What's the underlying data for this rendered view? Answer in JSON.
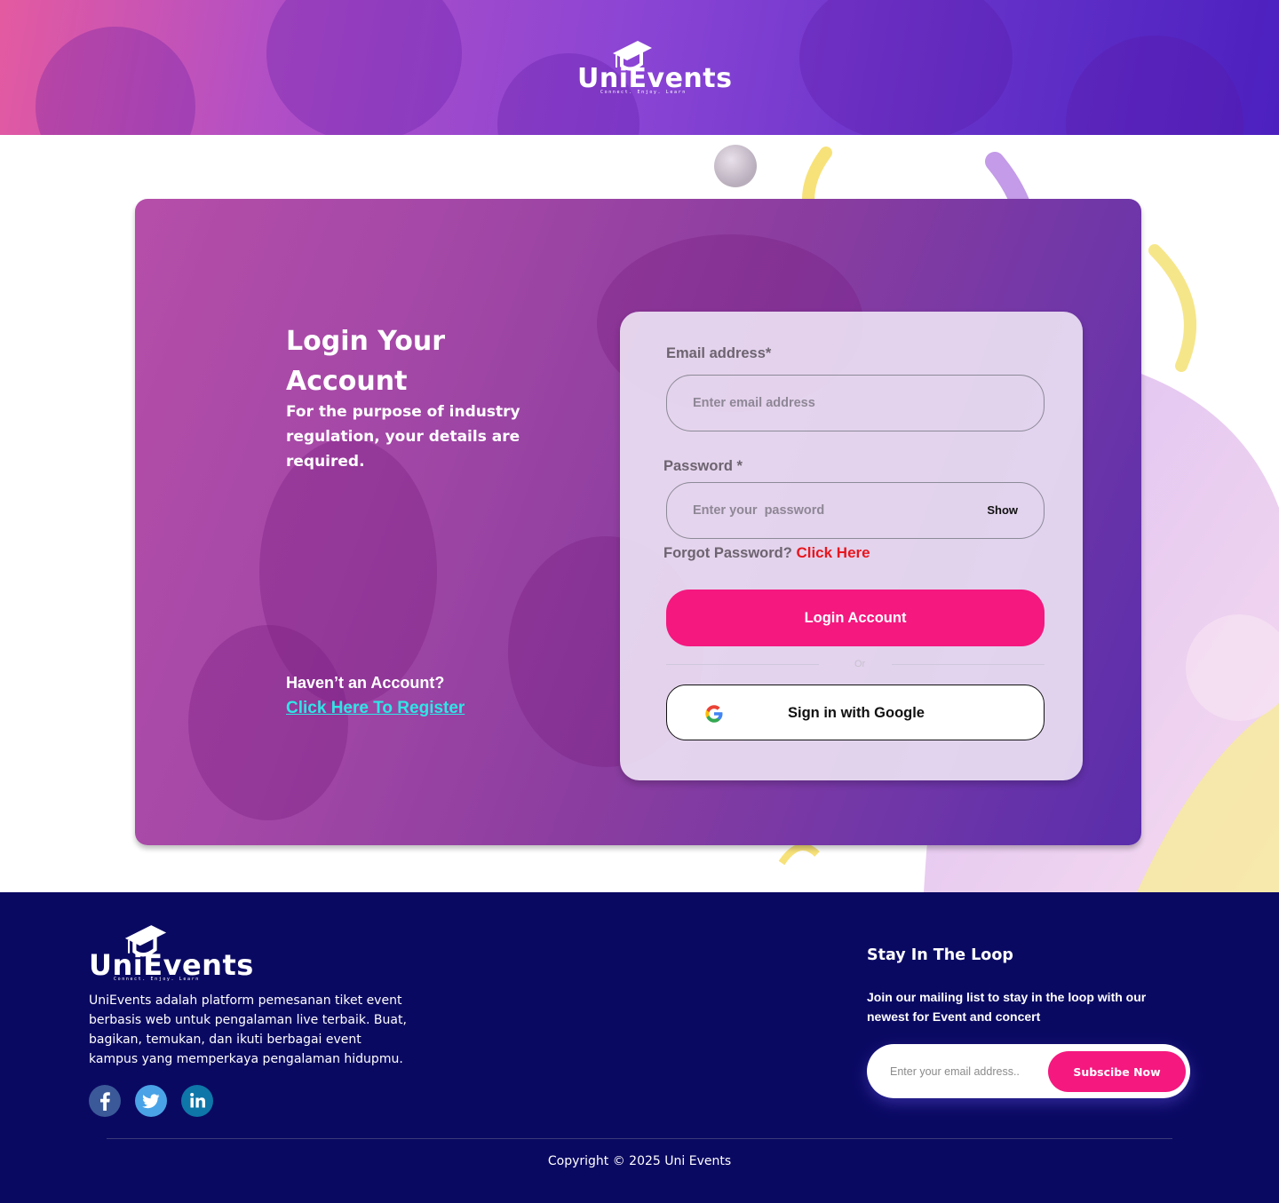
{
  "brand": {
    "name_prefix": "Uni",
    "name_suffix": "Events",
    "tagline": "Connect. Enjoy. Learn"
  },
  "login": {
    "title": "Login Your Account",
    "subtitle": "For the purpose of industry regulation, your details are required.",
    "no_account": "Haven’t  an Account?",
    "register_link": "Click Here To Register",
    "email_label": "Email address*",
    "email_placeholder": "Enter email address",
    "password_label": "Password *",
    "password_placeholder": "Enter your  password",
    "show_label": "Show",
    "forgot_text": "Forgot Password?",
    "forgot_link": "Click Here",
    "login_button": "Login Account",
    "or_text": "Or",
    "google_button": "Sign in with Google"
  },
  "footer": {
    "description": "UniEvents adalah platform pemesanan tiket event berbasis web untuk pengalaman live terbaik. Buat, bagikan, temukan, dan ikuti berbagai event kampus yang memperkaya pengalaman hidupmu.",
    "social": [
      "facebook-icon",
      "twitter-icon",
      "linkedin-icon"
    ],
    "newsletter_title": "Stay In The Loop",
    "newsletter_text": "Join our mailing list to stay in the loop with our newest for Event and concert",
    "newsletter_placeholder": "Enter your email address..",
    "subscribe_button": "Subscibe Now",
    "copyright": "Copyright © 2025 Uni Events"
  },
  "colors": {
    "accent": "#f4187f",
    "footer_bg": "#0a0962",
    "register_link": "#2ee6e6",
    "forgot_link": "#e8161e"
  }
}
